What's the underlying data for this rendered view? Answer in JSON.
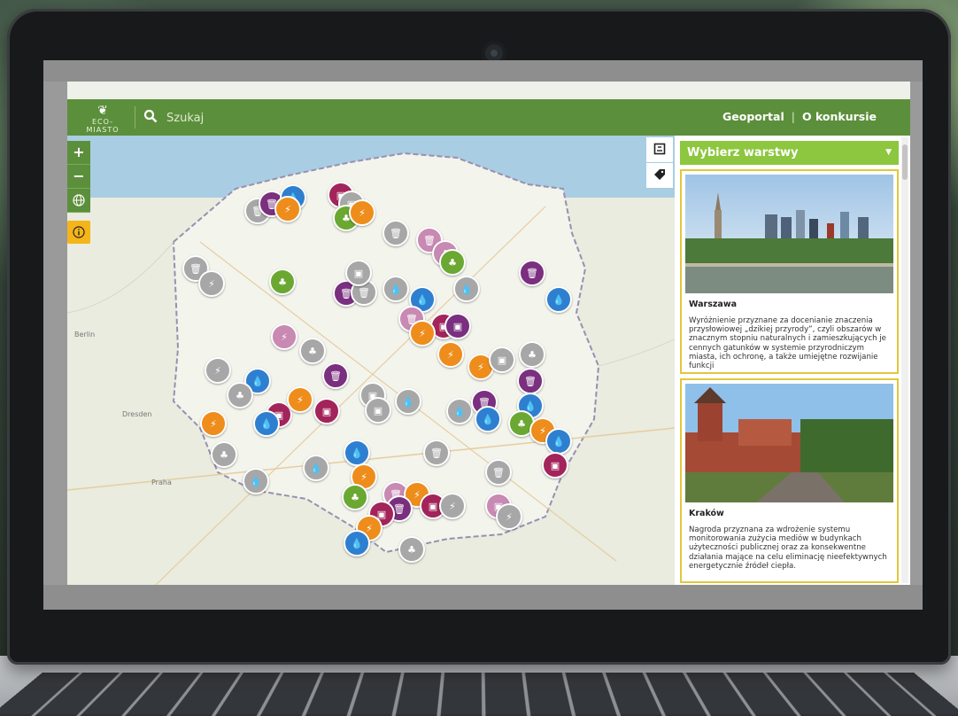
{
  "header": {
    "logo_text": "ECO-MIASTO",
    "search_placeholder": "Szukaj",
    "nav": [
      {
        "label": "Geoportal"
      },
      {
        "label": "O konkursie"
      }
    ]
  },
  "map": {
    "controls": [
      "+",
      "−"
    ],
    "labels": {
      "berlin": "Berlin",
      "dresden": "Dresden",
      "praha": "Praha"
    }
  },
  "panel": {
    "layers_label": "Wybierz warstwy",
    "cards": [
      {
        "city": "Warszawa",
        "description": "Wyróżnienie przyznane za docenianie znaczenia przysłowiowej „dzikiej przyrody”, czyli obszarów w znacznym stopniu naturalnych i zamieszkujących je cennych gatunków w systemie przyrodniczym miasta, ich ochronę, a także umiejętne rozwijanie funkcji"
      },
      {
        "city": "Kraków",
        "description": "Nagroda przyznana za wdrożenie systemu monitorowania zużycia mediów w budynkach użyteczności publicznej oraz za konsekwentne działania mające na celu eliminację nieefektywnych energetycznie źródeł ciepła."
      }
    ]
  },
  "colors": {
    "header_green": "#5c8f3b",
    "layer_green": "#8dc63f",
    "card_border": "#e2c73a",
    "info_yellow": "#f4b41a",
    "marker_purple": "#7a2f7f",
    "marker_crimson": "#a3245a",
    "marker_orange": "#ee8d1c",
    "marker_blue": "#2f7fd0",
    "marker_green": "#6aa832",
    "marker_gray": "#a7a7a7",
    "marker_pink": "#c889b3"
  },
  "icons": [
    "search-icon",
    "globe-icon",
    "info-icon",
    "legend-icon",
    "tag-icon",
    "bin-icon",
    "bus-icon",
    "plug-icon",
    "drop-icon",
    "tree-icon"
  ]
}
